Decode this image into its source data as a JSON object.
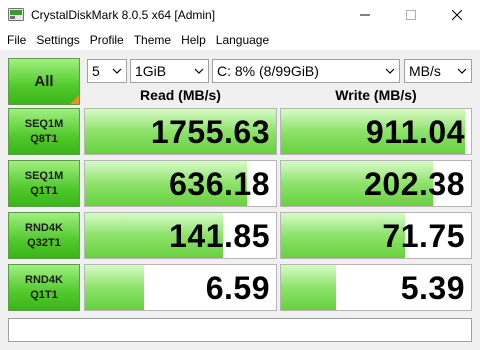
{
  "window": {
    "title": "CrystalDiskMark 8.0.5 x64 [Admin]"
  },
  "menu": [
    "File",
    "Settings",
    "Profile",
    "Theme",
    "Help",
    "Language"
  ],
  "controls": {
    "all_label": "All",
    "count": "5",
    "size": "1GiB",
    "drive": "C: 8% (8/99GiB)",
    "unit": "MB/s"
  },
  "headers": {
    "read": "Read (MB/s)",
    "write": "Write (MB/s)"
  },
  "tests": [
    {
      "line1": "SEQ1M",
      "line2": "Q8T1",
      "read": "1755.63",
      "write": "911.04",
      "read_fill": 1.0,
      "write_fill": 0.97
    },
    {
      "line1": "SEQ1M",
      "line2": "Q1T1",
      "read": "636.18",
      "write": "202.38",
      "read_fill": 0.85,
      "write_fill": 0.8
    },
    {
      "line1": "RND4K",
      "line2": "Q32T1",
      "read": "141.85",
      "write": "71.75",
      "read_fill": 0.72,
      "write_fill": 0.65
    },
    {
      "line1": "RND4K",
      "line2": "Q1T1",
      "read": "6.59",
      "write": "5.39",
      "read_fill": 0.31,
      "write_fill": 0.29
    }
  ],
  "comment": ""
}
